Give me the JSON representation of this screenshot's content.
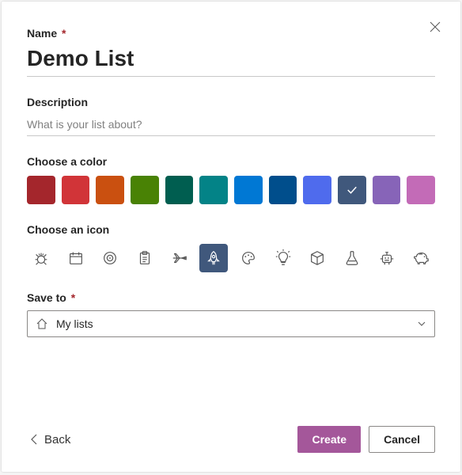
{
  "labels": {
    "name": "Name",
    "description": "Description",
    "chooseColor": "Choose a color",
    "chooseIcon": "Choose an icon",
    "saveTo": "Save to"
  },
  "required_marker": "*",
  "name": {
    "value": "Demo List"
  },
  "description": {
    "value": "",
    "placeholder": "What is your list about?"
  },
  "colors": [
    {
      "name": "dark-red",
      "hex": "#a4262c",
      "selected": false
    },
    {
      "name": "red",
      "hex": "#d13438",
      "selected": false
    },
    {
      "name": "orange",
      "hex": "#ca5010",
      "selected": false
    },
    {
      "name": "green",
      "hex": "#498205",
      "selected": false
    },
    {
      "name": "dark-teal",
      "hex": "#005e50",
      "selected": false
    },
    {
      "name": "teal",
      "hex": "#038387",
      "selected": false
    },
    {
      "name": "blue",
      "hex": "#0078d4",
      "selected": false
    },
    {
      "name": "dark-blue",
      "hex": "#004e8c",
      "selected": false
    },
    {
      "name": "periwinkle",
      "hex": "#4f6bed",
      "selected": false
    },
    {
      "name": "navy",
      "hex": "#40587c",
      "selected": true
    },
    {
      "name": "violet",
      "hex": "#8764b8",
      "selected": false
    },
    {
      "name": "pink",
      "hex": "#c36bb7",
      "selected": false
    }
  ],
  "icons": [
    {
      "name": "bug",
      "selected": false
    },
    {
      "name": "calendar",
      "selected": false
    },
    {
      "name": "target",
      "selected": false
    },
    {
      "name": "clipboard",
      "selected": false
    },
    {
      "name": "airplane",
      "selected": false
    },
    {
      "name": "rocket",
      "selected": true
    },
    {
      "name": "palette",
      "selected": false
    },
    {
      "name": "lightbulb",
      "selected": false
    },
    {
      "name": "cube",
      "selected": false
    },
    {
      "name": "flask",
      "selected": false
    },
    {
      "name": "robot",
      "selected": false
    },
    {
      "name": "piggybank",
      "selected": false
    }
  ],
  "saveTo": {
    "selected": "My lists"
  },
  "buttons": {
    "back": "Back",
    "create": "Create",
    "cancel": "Cancel"
  }
}
